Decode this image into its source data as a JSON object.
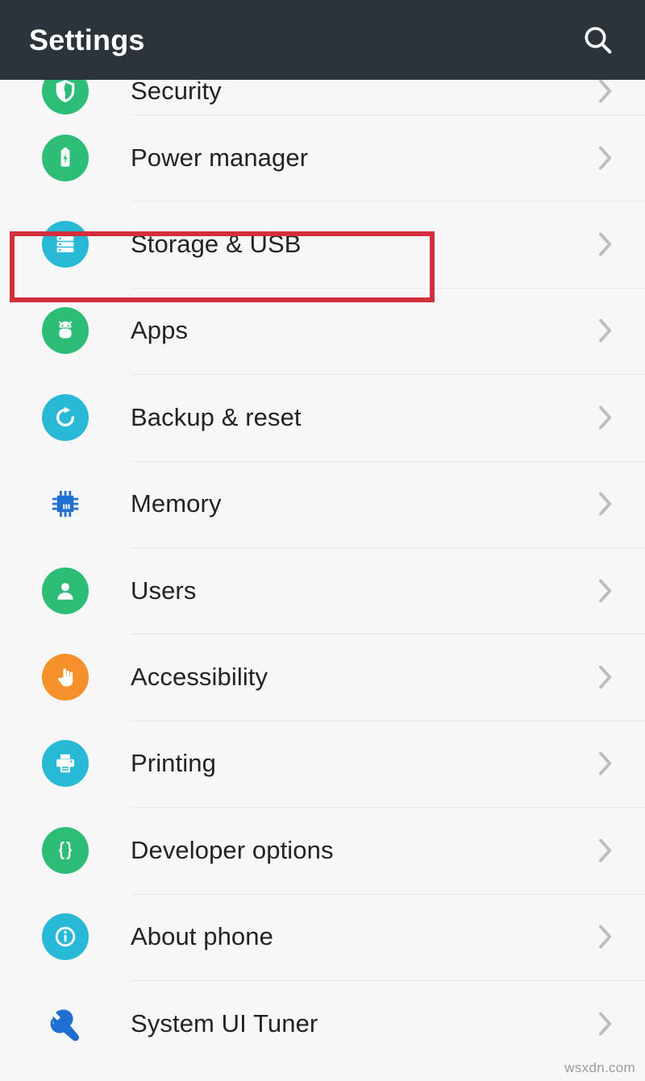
{
  "appbar": {
    "title": "Settings",
    "search_icon": "search-icon"
  },
  "colors": {
    "appbar_bg": "#2a343a",
    "page_bg": "#f7f7f7",
    "divider": "#e8e8e8",
    "label_text": "#232323",
    "chevron": "#bdbdbd",
    "highlight_border": "#d32f3a",
    "green": "#2ebd77",
    "cyan": "#28b9d6",
    "blue": "#1f6fd0",
    "orange": "#f5912a",
    "teal_green": "#2eb97a"
  },
  "list": {
    "items": [
      {
        "label": "Security",
        "icon": "shield-icon",
        "icon_style": "badge",
        "icon_color": "#2ebd77",
        "clipped": true
      },
      {
        "label": "Power manager",
        "icon": "battery-icon",
        "icon_style": "badge",
        "icon_color": "#2ebd77",
        "clipped": false
      },
      {
        "label": "Storage & USB",
        "icon": "storage-icon",
        "icon_style": "badge",
        "icon_color": "#28b9d6",
        "clipped": false
      },
      {
        "label": "Apps",
        "icon": "android-robot-icon",
        "icon_style": "badge",
        "icon_color": "#2ebd77",
        "clipped": false,
        "highlighted": true
      },
      {
        "label": "Backup & reset",
        "icon": "refresh-icon",
        "icon_style": "badge",
        "icon_color": "#28b9d6",
        "clipped": false
      },
      {
        "label": "Memory",
        "icon": "memory-chip-icon",
        "icon_style": "plain",
        "icon_color": "#1f6fd0",
        "clipped": false
      },
      {
        "label": "Users",
        "icon": "person-icon",
        "icon_style": "badge",
        "icon_color": "#2ebd77",
        "clipped": false
      },
      {
        "label": "Accessibility",
        "icon": "hand-pointer-icon",
        "icon_style": "badge",
        "icon_color": "#f5912a",
        "clipped": false
      },
      {
        "label": "Printing",
        "icon": "printer-icon",
        "icon_style": "badge",
        "icon_color": "#28b9d6",
        "clipped": false
      },
      {
        "label": "Developer options",
        "icon": "curly-braces-icon",
        "icon_style": "badge",
        "icon_color": "#2ebd77",
        "clipped": false
      },
      {
        "label": "About phone",
        "icon": "info-icon",
        "icon_style": "badge",
        "icon_color": "#28b9d6",
        "clipped": false
      },
      {
        "label": "System UI Tuner",
        "icon": "wrench-icon",
        "icon_style": "plain",
        "icon_color": "#1f6fd0",
        "clipped": false
      }
    ],
    "chevron_glyph": "›"
  },
  "annotation": {
    "target_label": "Apps",
    "border_color": "#d32f3a"
  },
  "watermark": {
    "text": "wsxdn.com"
  }
}
